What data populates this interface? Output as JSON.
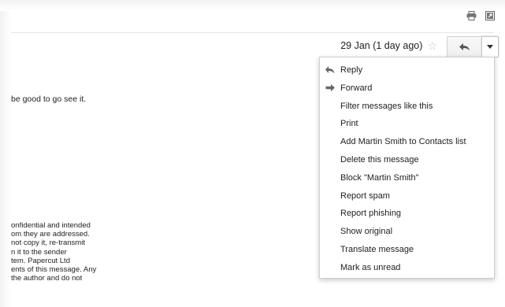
{
  "header": {
    "print_icon": "print-icon",
    "newwindow_icon": "new-window-icon"
  },
  "message": {
    "date": "29 Jan (1 day ago)",
    "snippet": "be good to go see it.",
    "disclaimer_lines": [
      "onfidential and intended",
      "om they are addressed.",
      "not copy it, re-transmit",
      "n it to the sender",
      "tem. Papercut Ltd",
      "ents of this message. Any",
      "the author and do not"
    ]
  },
  "menu": {
    "items": [
      {
        "label": "Reply",
        "icon": "reply-icon"
      },
      {
        "label": "Forward",
        "icon": "forward-icon"
      },
      {
        "label": "Filter messages like this"
      },
      {
        "label": "Print"
      },
      {
        "label": "Add Martin Smith to Contacts list"
      },
      {
        "label": "Delete this message"
      },
      {
        "label": "Block \"Martin Smith\""
      },
      {
        "label": "Report spam"
      },
      {
        "label": "Report phishing"
      },
      {
        "label": "Show original"
      },
      {
        "label": "Translate message"
      },
      {
        "label": "Mark as unread"
      }
    ]
  }
}
